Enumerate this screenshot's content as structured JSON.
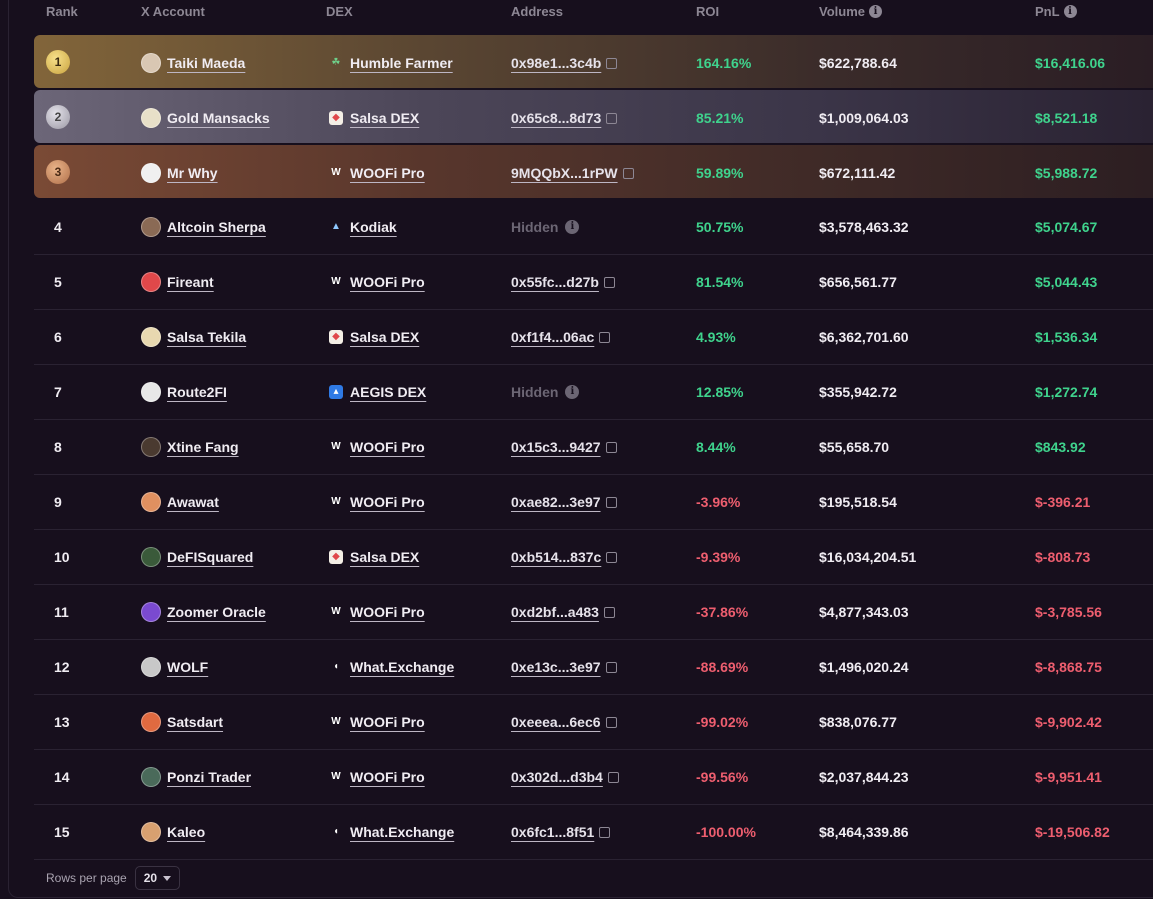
{
  "headers": {
    "rank": "Rank",
    "account": "X Account",
    "dex": "DEX",
    "address": "Address",
    "roi": "ROI",
    "volume": "Volume",
    "pnl": "PnL"
  },
  "rows": [
    {
      "rank": "1",
      "account": "Taiki Maeda",
      "avatar_color": "#d9c7b3",
      "dex": "Humble Farmer",
      "dex_icon": "sprout-icon",
      "address": "0x98e1...3c4b",
      "roi": "164.16%",
      "volume": "$622,788.64",
      "pnl": "$16,416.06",
      "sign": "pos"
    },
    {
      "rank": "2",
      "account": "Gold Mansacks",
      "avatar_color": "#e8e0c8",
      "dex": "Salsa DEX",
      "dex_icon": "salsa-icon",
      "address": "0x65c8...8d73",
      "roi": "85.21%",
      "volume": "$1,009,064.03",
      "pnl": "$8,521.18",
      "sign": "pos"
    },
    {
      "rank": "3",
      "account": "Mr Why",
      "avatar_color": "#f0f0f0",
      "dex": "WOOFi Pro",
      "dex_icon": "woofi-icon",
      "address": "9MQQbX...1rPW",
      "roi": "59.89%",
      "volume": "$672,111.42",
      "pnl": "$5,988.72",
      "sign": "pos"
    },
    {
      "rank": "4",
      "account": "Altcoin Sherpa",
      "avatar_color": "#8a6a55",
      "dex": "Kodiak",
      "dex_icon": "kodiak-icon",
      "address": "Hidden",
      "hidden": true,
      "roi": "50.75%",
      "volume": "$3,578,463.32",
      "pnl": "$5,074.67",
      "sign": "pos"
    },
    {
      "rank": "5",
      "account": "Fireant",
      "avatar_color": "#e0484a",
      "dex": "WOOFi Pro",
      "dex_icon": "woofi-icon",
      "address": "0x55fc...d27b",
      "roi": "81.54%",
      "volume": "$656,561.77",
      "pnl": "$5,044.43",
      "sign": "pos"
    },
    {
      "rank": "6",
      "account": "Salsa Tekila",
      "avatar_color": "#e8d8b0",
      "dex": "Salsa DEX",
      "dex_icon": "salsa-icon",
      "address": "0xf1f4...06ac",
      "roi": "4.93%",
      "volume": "$6,362,701.60",
      "pnl": "$1,536.34",
      "sign": "pos"
    },
    {
      "rank": "7",
      "account": "Route2FI",
      "avatar_color": "#e8e8e8",
      "dex": "AEGIS DEX",
      "dex_icon": "aegis-icon",
      "address": "Hidden",
      "hidden": true,
      "roi": "12.85%",
      "volume": "$355,942.72",
      "pnl": "$1,272.74",
      "sign": "pos"
    },
    {
      "rank": "8",
      "account": "Xtine Fang",
      "avatar_color": "#4a3a30",
      "dex": "WOOFi Pro",
      "dex_icon": "woofi-icon",
      "address": "0x15c3...9427",
      "roi": "8.44%",
      "volume": "$55,658.70",
      "pnl": "$843.92",
      "sign": "pos"
    },
    {
      "rank": "9",
      "account": "Awawat",
      "avatar_color": "#e09060",
      "dex": "WOOFi Pro",
      "dex_icon": "woofi-icon",
      "address": "0xae82...3e97",
      "roi": "-3.96%",
      "volume": "$195,518.54",
      "pnl": "$-396.21",
      "sign": "neg"
    },
    {
      "rank": "10",
      "account": "DeFISquared",
      "avatar_color": "#3a5a3a",
      "dex": "Salsa DEX",
      "dex_icon": "salsa-icon",
      "address": "0xb514...837c",
      "roi": "-9.39%",
      "volume": "$16,034,204.51",
      "pnl": "$-808.73",
      "sign": "neg"
    },
    {
      "rank": "11",
      "account": "Zoomer Oracle",
      "avatar_color": "#7a4ad0",
      "dex": "WOOFi Pro",
      "dex_icon": "woofi-icon",
      "address": "0xd2bf...a483",
      "roi": "-37.86%",
      "volume": "$4,877,343.03",
      "pnl": "$-3,785.56",
      "sign": "neg"
    },
    {
      "rank": "12",
      "account": "WOLF",
      "avatar_color": "#c8c8c8",
      "dex": "What.Exchange",
      "dex_icon": "whatexchange-icon",
      "address": "0xe13c...3e97",
      "roi": "-88.69%",
      "volume": "$1,496,020.24",
      "pnl": "$-8,868.75",
      "sign": "neg"
    },
    {
      "rank": "13",
      "account": "Satsdart",
      "avatar_color": "#e06a40",
      "dex": "WOOFi Pro",
      "dex_icon": "woofi-icon",
      "address": "0xeeea...6ec6",
      "roi": "-99.02%",
      "volume": "$838,076.77",
      "pnl": "$-9,902.42",
      "sign": "neg"
    },
    {
      "rank": "14",
      "account": "Ponzi Trader",
      "avatar_color": "#4a6a5a",
      "dex": "WOOFi Pro",
      "dex_icon": "woofi-icon",
      "address": "0x302d...d3b4",
      "roi": "-99.56%",
      "volume": "$2,037,844.23",
      "pnl": "$-9,951.41",
      "sign": "neg"
    },
    {
      "rank": "15",
      "account": "Kaleo",
      "avatar_color": "#d8a070",
      "dex": "What.Exchange",
      "dex_icon": "whatexchange-icon",
      "address": "0x6fc1...8f51",
      "roi": "-100.00%",
      "volume": "$8,464,339.86",
      "pnl": "$-19,506.82",
      "sign": "neg"
    }
  ],
  "footer": {
    "rows_per_page_label": "Rows per page",
    "rows_per_page_value": "20"
  },
  "colors": {
    "positive": "#3fd38d",
    "negative": "#ee5e6f",
    "background": "#170f1d"
  }
}
